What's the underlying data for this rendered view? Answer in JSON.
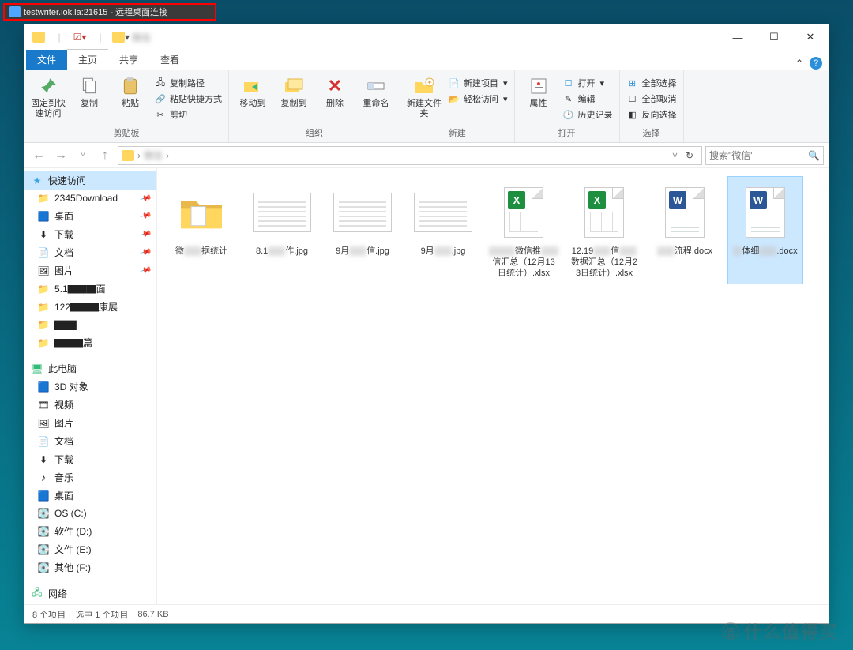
{
  "rdp": {
    "title": "testwriter.iok.la:21615 - 远程桌面连接"
  },
  "window": {
    "min": "—",
    "max": "☐",
    "close": "✕"
  },
  "tabs": {
    "file": "文件",
    "home": "主页",
    "share": "共享",
    "view": "查看",
    "collapse": "⌃",
    "help": "?"
  },
  "ribbon": {
    "clipboard": {
      "pin": "固定到快速访问",
      "copy": "复制",
      "paste": "粘贴",
      "copy_path": "复制路径",
      "paste_shortcut": "粘贴快捷方式",
      "cut": "剪切",
      "group": "剪贴板"
    },
    "organize": {
      "moveto": "移动到",
      "copyto": "复制到",
      "delete": "删除",
      "rename": "重命名",
      "group": "组织"
    },
    "new": {
      "newfolder": "新建文件夹",
      "newitem": "新建项目",
      "easyaccess": "轻松访问",
      "group": "新建"
    },
    "open": {
      "properties": "属性",
      "open": "打开",
      "edit": "编辑",
      "history": "历史记录",
      "group": "打开"
    },
    "select": {
      "selectall": "全部选择",
      "selectnone": "全部取消",
      "invert": "反向选择",
      "group": "选择"
    }
  },
  "addr": {
    "sep1": "›",
    "sep2": "›",
    "refresh": "↻"
  },
  "search": {
    "placeholder": "搜索\"微信\"",
    "icon": "🔍"
  },
  "nav": {
    "back": "←",
    "fwd": "→",
    "up": "↑"
  },
  "sidebar": {
    "quick": "快速访问",
    "items_quick": [
      {
        "label": "2345Download"
      },
      {
        "label": "桌面"
      },
      {
        "label": "下载"
      },
      {
        "label": "文档"
      },
      {
        "label": "图片"
      },
      {
        "label": "5.1▇▇▇面"
      },
      {
        "label": "122▇▇▇康展"
      },
      {
        "label": "▇▇▇"
      },
      {
        "label": "▇▇▇篇"
      }
    ],
    "thispc": "此电脑",
    "items_pc": [
      {
        "label": "3D 对象"
      },
      {
        "label": "视频"
      },
      {
        "label": "图片"
      },
      {
        "label": "文档"
      },
      {
        "label": "下载"
      },
      {
        "label": "音乐"
      },
      {
        "label": "桌面"
      },
      {
        "label": "OS (C:)"
      },
      {
        "label": "软件 (D:)"
      },
      {
        "label": "文件 (E:)"
      },
      {
        "label": "其他 (F:)"
      }
    ],
    "network": "网络"
  },
  "files": [
    {
      "type": "folder",
      "name": "微▇▇据统计"
    },
    {
      "type": "img",
      "name": "8.1▇▇作.jpg"
    },
    {
      "type": "img",
      "name": "9月▇▇信.jpg"
    },
    {
      "type": "img",
      "name": "9月▇▇.jpg"
    },
    {
      "type": "xlsx",
      "name": "▇▇▇微信推▇▇信汇总（12月13日统计）.xlsx"
    },
    {
      "type": "xlsx",
      "name": "12.19▇▇信▇▇数据汇总（12月23日统计）.xlsx"
    },
    {
      "type": "docx",
      "name": "▇▇流程.docx"
    },
    {
      "type": "docx",
      "name": "▇体细▇▇.docx",
      "selected": true
    }
  ],
  "status": {
    "count": "8 个项目",
    "sel": "选中 1 个项目",
    "size": "86.7 KB"
  },
  "watermark": {
    "text": "什么值得买",
    "icon": "值"
  }
}
